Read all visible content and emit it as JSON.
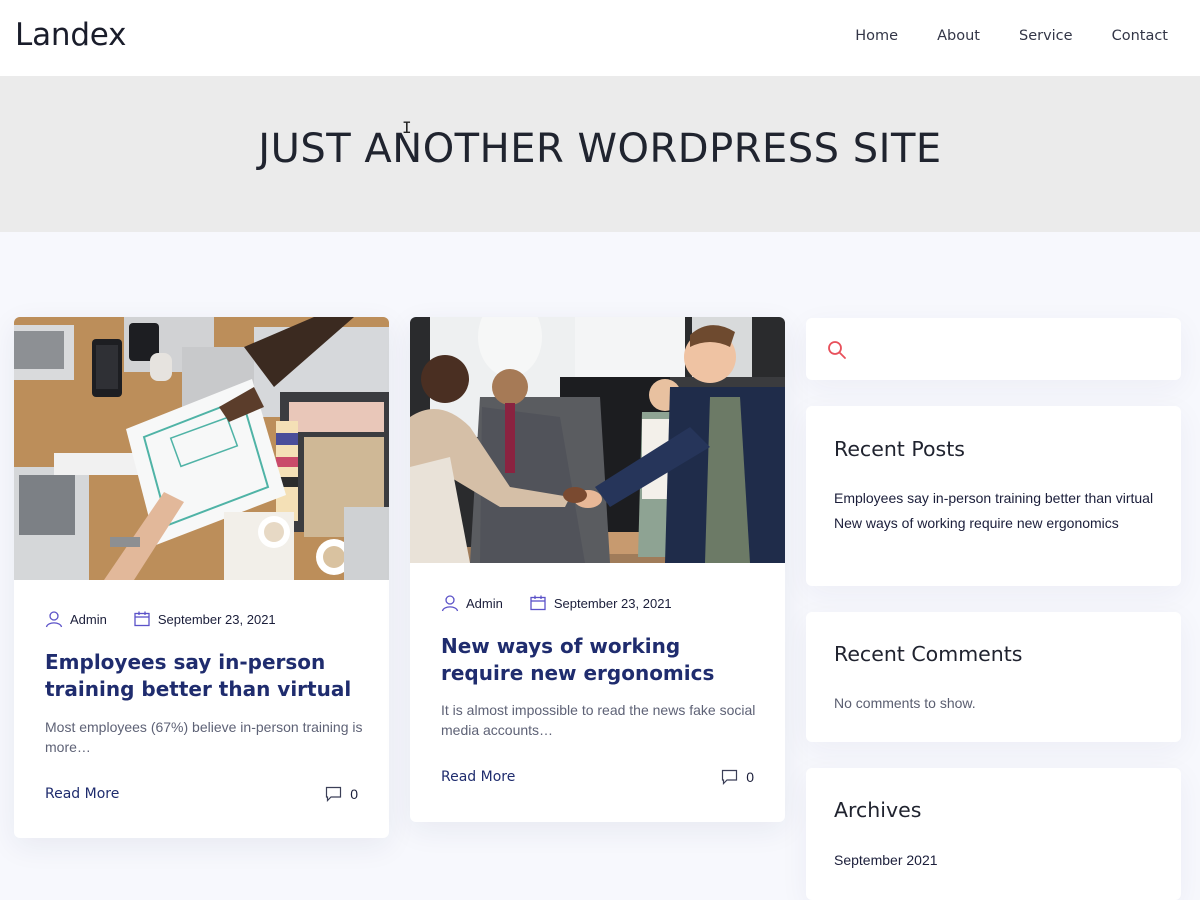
{
  "site": {
    "logo": "Landex"
  },
  "nav": [
    {
      "label": "Home"
    },
    {
      "label": "About"
    },
    {
      "label": "Service"
    },
    {
      "label": "Contact"
    }
  ],
  "banner": {
    "title": "JUST ANOTHER WORDPRESS SITE"
  },
  "posts": [
    {
      "author": "Admin",
      "date": "September 23, 2021",
      "title": "Employees say in-person training better than virtual",
      "excerpt": "Most employees (67%) believe in-person training is more…",
      "read_more": "Read More",
      "comment_count": "0"
    },
    {
      "author": "Admin",
      "date": "September 23, 2021",
      "title": "New ways of working require new ergonomics",
      "excerpt": "It is almost impossible to read the news fake social media accounts…",
      "read_more": "Read More",
      "comment_count": "0"
    }
  ],
  "sidebar": {
    "search": {
      "placeholder": ""
    },
    "recent_posts": {
      "title": "Recent Posts",
      "items": [
        {
          "label": "Employees say in-person training better than virtual"
        },
        {
          "label": "New ways of working require new ergonomics"
        }
      ]
    },
    "recent_comments": {
      "title": "Recent Comments",
      "empty_text": "No comments to show."
    },
    "archives": {
      "title": "Archives",
      "items": [
        {
          "label": "September 2021"
        }
      ]
    }
  },
  "colors": {
    "accent": "#e8505b",
    "meta_icon": "#5b52c8",
    "title_blue": "#1f2c6e",
    "banner_bg": "#ebebeb",
    "page_bg": "#f7f8fd"
  },
  "icons": {
    "author": "user-icon",
    "date": "calendar-icon",
    "comments": "comment-bubble-icon",
    "search": "search-icon"
  }
}
